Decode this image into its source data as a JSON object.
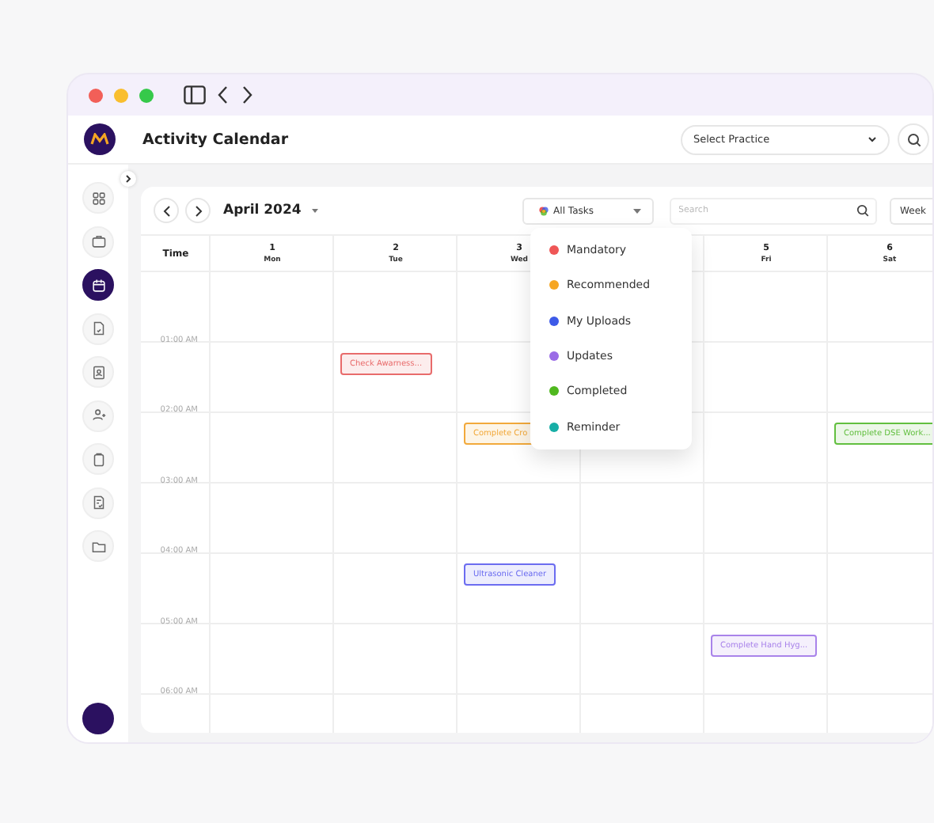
{
  "header": {
    "title": "Activity Calendar",
    "practice_select": {
      "placeholder": "Select Practice"
    }
  },
  "sidebar": {
    "items": [
      {
        "kind": "grid",
        "selected": false
      },
      {
        "kind": "briefcase",
        "selected": false
      },
      {
        "kind": "calendar",
        "selected": true
      },
      {
        "kind": "document",
        "selected": false
      },
      {
        "kind": "badge",
        "selected": false
      },
      {
        "kind": "users",
        "selected": false
      },
      {
        "kind": "clipboard",
        "selected": false
      },
      {
        "kind": "checklist",
        "selected": false
      },
      {
        "kind": "folder",
        "selected": false
      }
    ]
  },
  "toolbar": {
    "month": "April 2024",
    "filter": "All Tasks",
    "search": {
      "placeholder": "Search"
    },
    "view": "Week"
  },
  "calendar": {
    "time_heading": "Time",
    "days": [
      {
        "kind": "day",
        "date": "1",
        "weekday": "Mon"
      },
      {
        "kind": "day",
        "date": "2",
        "weekday": "Tue"
      },
      {
        "kind": "day",
        "date": "3",
        "weekday": "Wed"
      },
      {
        "kind": "covered"
      },
      {
        "kind": "day",
        "date": "5",
        "weekday": "Fri"
      },
      {
        "kind": "day",
        "date": "6",
        "weekday": "Sat"
      }
    ],
    "rows": [
      {},
      {
        "time": "01:00 AM",
        "cells": [
          {
            "kind": "blank"
          },
          {
            "kind": "event",
            "title": "Check Awarness...",
            "color": "#e86b6b"
          }
        ]
      },
      {
        "time": "02:00 AM",
        "cells": [
          {
            "kind": "blank"
          },
          {
            "kind": "blank"
          },
          {
            "kind": "event",
            "title": "Complete Cro",
            "color": "#f2a93b"
          },
          {
            "kind": "blank"
          },
          {
            "kind": "blank"
          },
          {
            "kind": "event",
            "title": "Complete DSE Work...",
            "color": "#62bf3f"
          }
        ]
      },
      {
        "time": "03:00 AM"
      },
      {
        "time": "04:00 AM",
        "cells": [
          {
            "kind": "blank"
          },
          {
            "kind": "blank"
          },
          {
            "kind": "event",
            "title": "Ultrasonic Cleaner",
            "color": "#6b6cf0"
          }
        ]
      },
      {
        "time": "05:00 AM",
        "cells": [
          {
            "kind": "blank"
          },
          {
            "kind": "blank"
          },
          {
            "kind": "blank"
          },
          {
            "kind": "blank"
          },
          {
            "kind": "event",
            "title": "Complete Hand Hyg...",
            "color": "#a983ea"
          }
        ]
      },
      {
        "time": "06:00 AM"
      }
    ]
  },
  "filter_menu": {
    "items": [
      {
        "label": "Mandatory",
        "color": "#ef5656"
      },
      {
        "label": "Recommended",
        "color": "#f6a623"
      },
      {
        "label": "My Uploads",
        "color": "#3d5ae8"
      },
      {
        "label": "Updates",
        "color": "#9a6be6"
      },
      {
        "label": "Completed",
        "color": "#4fb81e"
      },
      {
        "label": "Reminder",
        "color": "#17aea6"
      }
    ]
  }
}
